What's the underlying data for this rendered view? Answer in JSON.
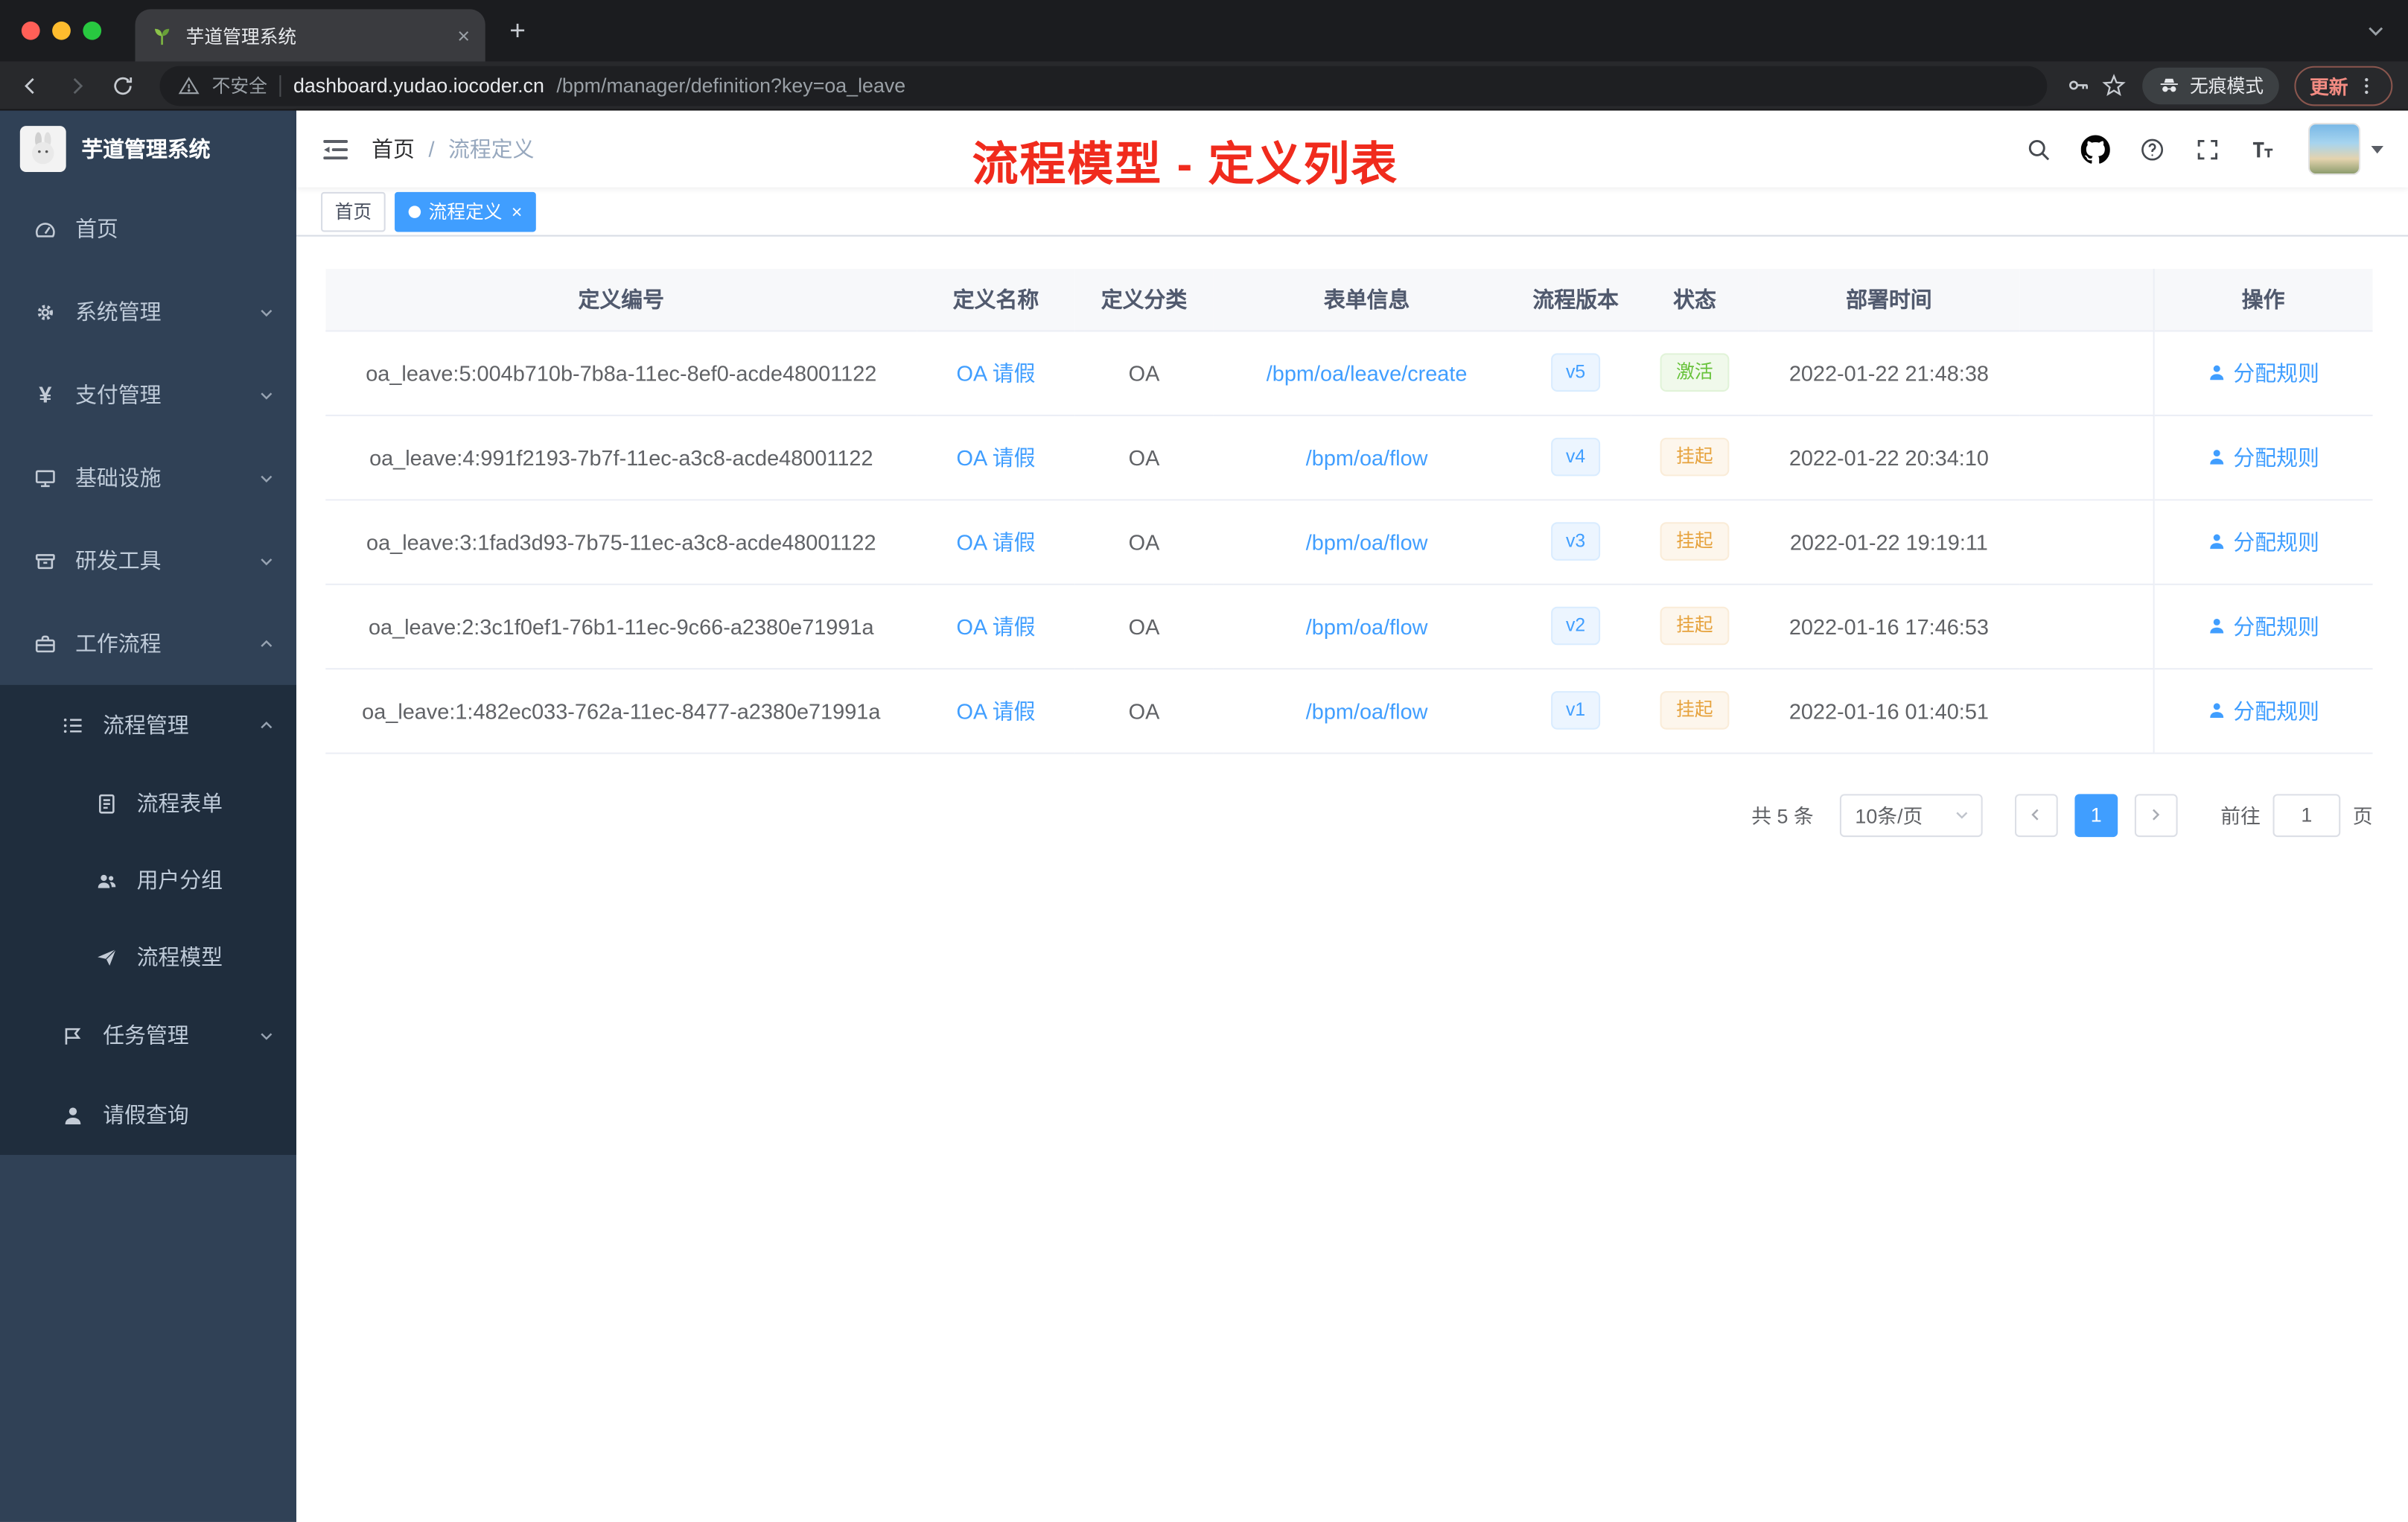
{
  "browser": {
    "tab_title": "芋道管理系统",
    "security_label": "不安全",
    "url_host": "dashboard.yudao.iocoder.cn",
    "url_path": "/bpm/manager/definition?key=oa_leave",
    "incognito_label": "无痕模式",
    "update_label": "更新"
  },
  "sidebar": {
    "logo_title": "芋道管理系统",
    "items": [
      {
        "label": "首页"
      },
      {
        "label": "系统管理"
      },
      {
        "label": "支付管理"
      },
      {
        "label": "基础设施"
      },
      {
        "label": "研发工具"
      },
      {
        "label": "工作流程"
      }
    ],
    "workflow": {
      "process_mgmt": {
        "label": "流程管理"
      },
      "children": [
        {
          "label": "流程表单"
        },
        {
          "label": "用户分组"
        },
        {
          "label": "流程模型"
        }
      ],
      "task_mgmt": {
        "label": "任务管理"
      },
      "leave_query": {
        "label": "请假查询"
      }
    }
  },
  "header": {
    "breadcrumb_home": "首页",
    "breadcrumb_sep": "/",
    "breadcrumb_current": "流程定义",
    "annotation": "流程模型 - 定义列表"
  },
  "tags": {
    "home": "首页",
    "current": "流程定义"
  },
  "table": {
    "columns": [
      "定义编号",
      "定义名称",
      "定义分类",
      "表单信息",
      "流程版本",
      "状态",
      "部署时间",
      "操作"
    ],
    "rows": [
      {
        "id": "oa_leave:5:004b710b-7b8a-11ec-8ef0-acde48001122",
        "name": "OA 请假",
        "category": "OA",
        "form": "/bpm/oa/leave/create",
        "version": "v5",
        "status": "激活",
        "status_type": "success",
        "deploy_time": "2022-01-22 21:48:38",
        "action": "分配规则"
      },
      {
        "id": "oa_leave:4:991f2193-7b7f-11ec-a3c8-acde48001122",
        "name": "OA 请假",
        "category": "OA",
        "form": "/bpm/oa/flow",
        "version": "v4",
        "status": "挂起",
        "status_type": "warning",
        "deploy_time": "2022-01-22 20:34:10",
        "action": "分配规则"
      },
      {
        "id": "oa_leave:3:1fad3d93-7b75-11ec-a3c8-acde48001122",
        "name": "OA 请假",
        "category": "OA",
        "form": "/bpm/oa/flow",
        "version": "v3",
        "status": "挂起",
        "status_type": "warning",
        "deploy_time": "2022-01-22 19:19:11",
        "action": "分配规则"
      },
      {
        "id": "oa_leave:2:3c1f0ef1-76b1-11ec-9c66-a2380e71991a",
        "name": "OA 请假",
        "category": "OA",
        "form": "/bpm/oa/flow",
        "version": "v2",
        "status": "挂起",
        "status_type": "warning",
        "deploy_time": "2022-01-16 17:46:53",
        "action": "分配规则"
      },
      {
        "id": "oa_leave:1:482ec033-762a-11ec-8477-a2380e71991a",
        "name": "OA 请假",
        "category": "OA",
        "form": "/bpm/oa/flow",
        "version": "v1",
        "status": "挂起",
        "status_type": "warning",
        "deploy_time": "2022-01-16 01:40:51",
        "action": "分配规则"
      }
    ]
  },
  "pagination": {
    "total": "共 5 条",
    "page_size": "10条/页",
    "current_page": "1",
    "goto_label": "前往",
    "goto_value": "1",
    "page_unit": "页"
  },
  "colors": {
    "accent": "#409EFF",
    "success": "#67C23A",
    "warning": "#E6A23C",
    "annotation_red": "#F02B1D",
    "sidebar_bg": "#304156",
    "submenu_bg": "#1F2D3D"
  }
}
